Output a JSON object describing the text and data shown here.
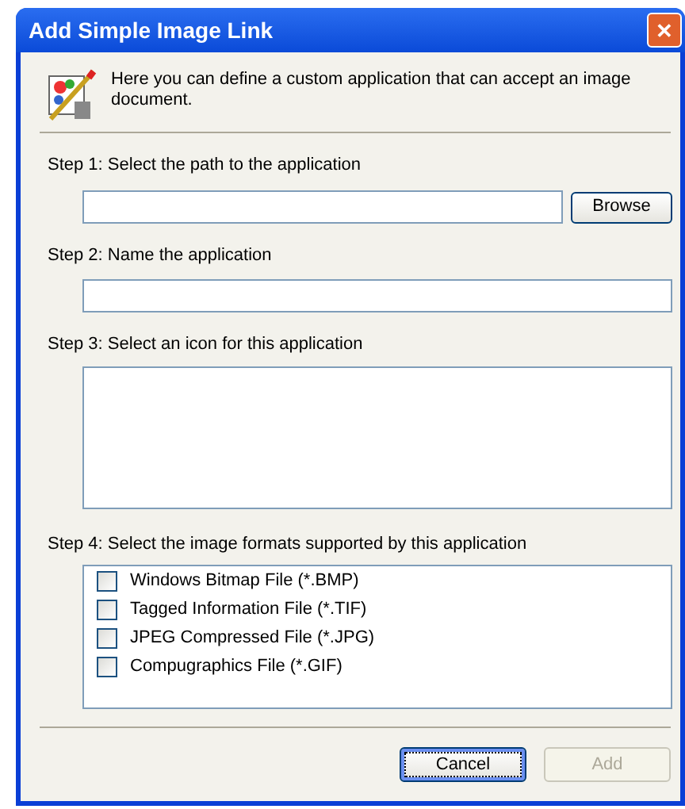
{
  "window": {
    "title": "Add Simple Image Link",
    "close": "✕"
  },
  "intro": "Here you can define a custom application that can accept an image document.",
  "step1": {
    "label": "Step 1: Select the path to the application",
    "browse": "Browse"
  },
  "step2": {
    "label": "Step 2: Name the application"
  },
  "step3": {
    "label": "Step 3: Select an icon for this application"
  },
  "step4": {
    "label": "Step 4: Select the image formats supported by this application",
    "formats": [
      {
        "label": "Windows Bitmap File (*.BMP)",
        "checked": false
      },
      {
        "label": "Tagged Information File (*.TIF)",
        "checked": false
      },
      {
        "label": "JPEG Compressed File (*.JPG)",
        "checked": false
      },
      {
        "label": "Compugraphics File (*.GIF)",
        "checked": false
      }
    ]
  },
  "buttons": [
    {
      "label": "Cancel",
      "disabled": false,
      "focused": true
    },
    {
      "label": "Add",
      "disabled": true,
      "focused": false
    }
  ]
}
